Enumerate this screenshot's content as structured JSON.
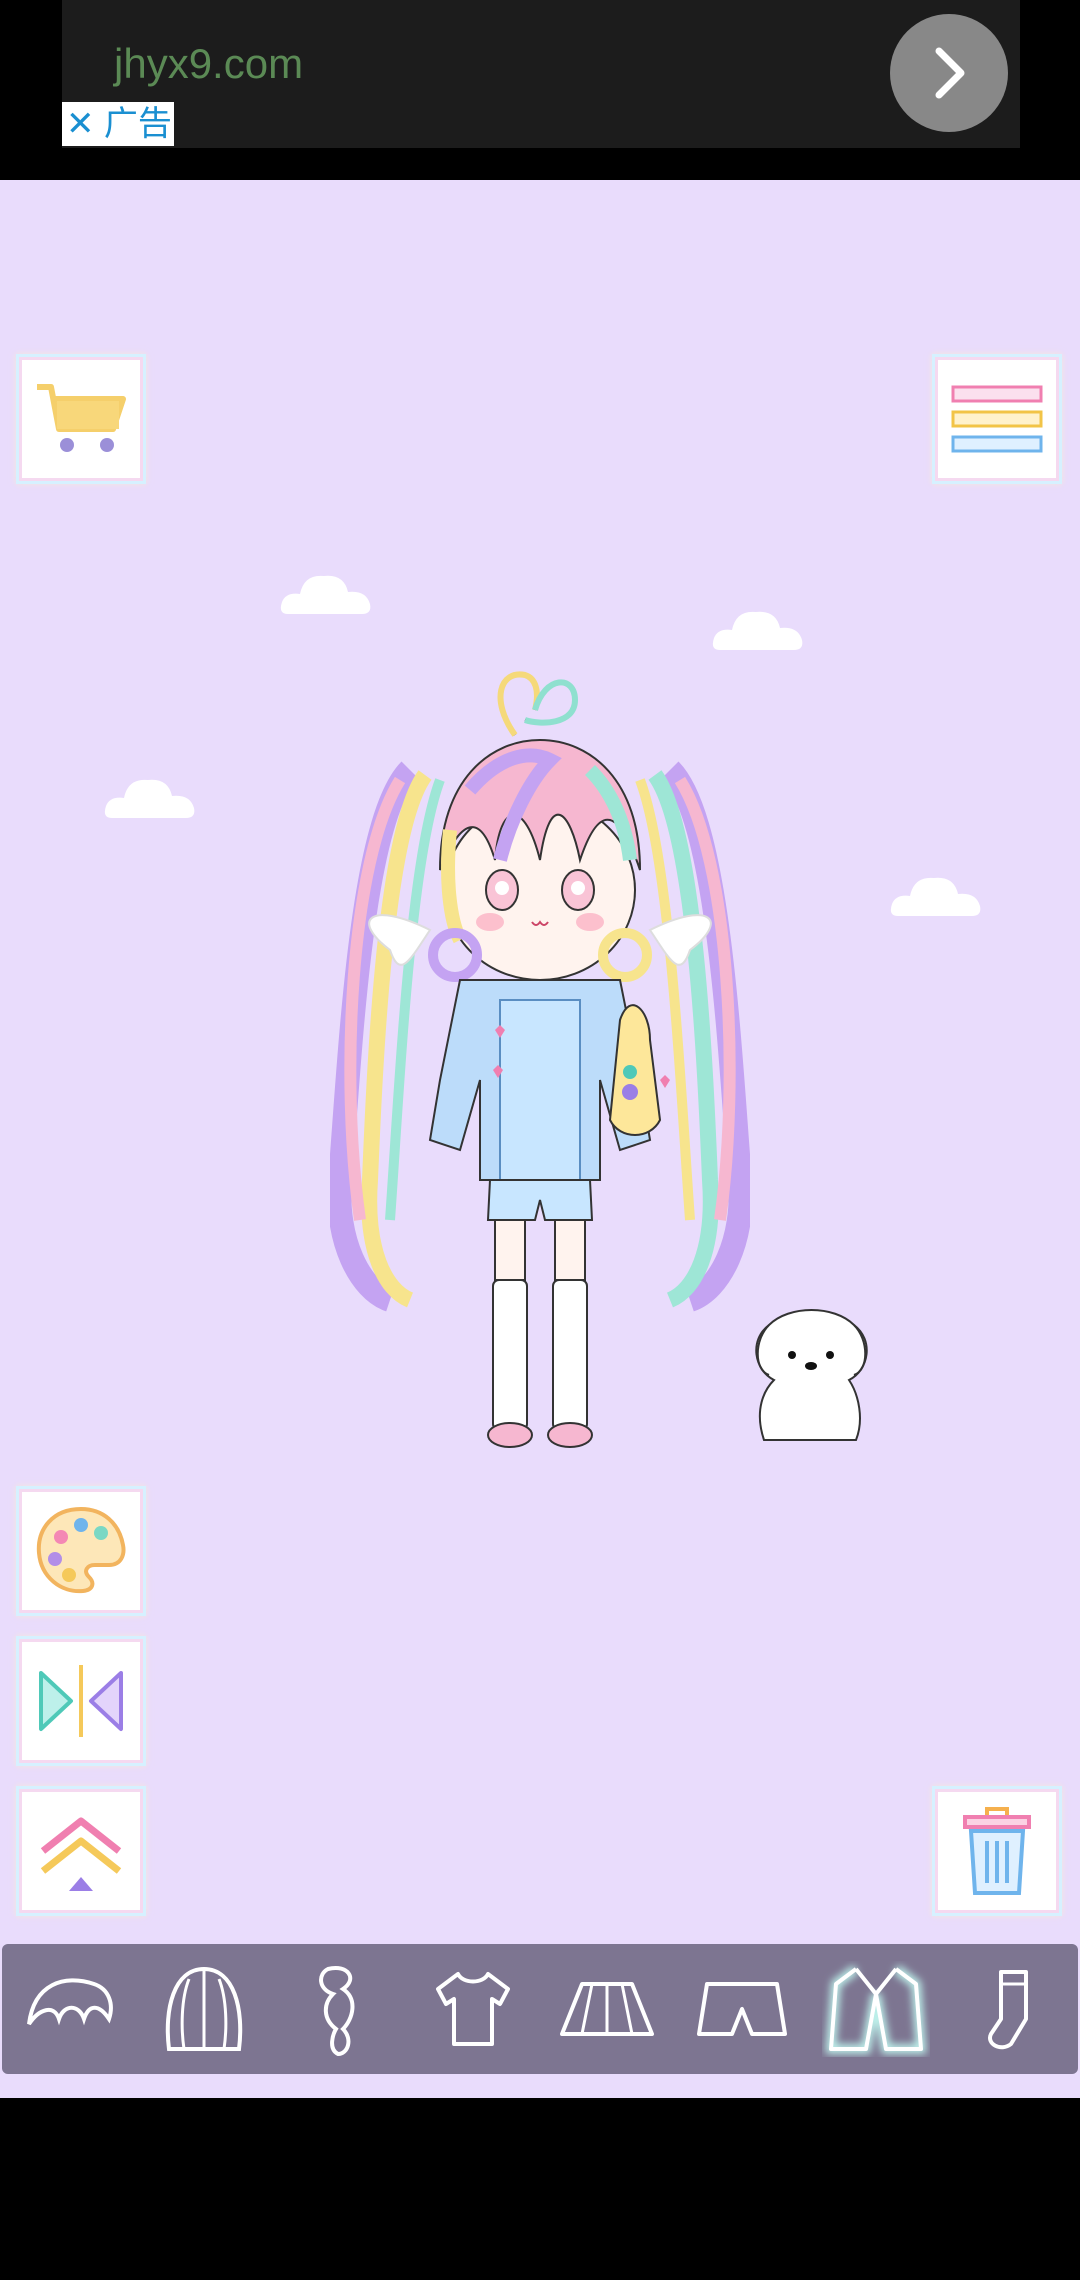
{
  "ad": {
    "url": "jhyx9.com",
    "close_label": "✕ 广告"
  },
  "tiles": {
    "shop": "cart-icon",
    "menu": "menu-icon",
    "palette": "palette-icon",
    "flip": "flip-icon",
    "layer_up": "layer-up-icon",
    "delete": "trash-icon"
  },
  "toolbar": {
    "categories": [
      "bangs",
      "back-hair",
      "side-hair",
      "top",
      "skirt",
      "shorts",
      "outfit",
      "socks"
    ],
    "selected": "outfit"
  },
  "colors": {
    "background": "#e9dcfc",
    "toolbar": "#7d7591"
  }
}
